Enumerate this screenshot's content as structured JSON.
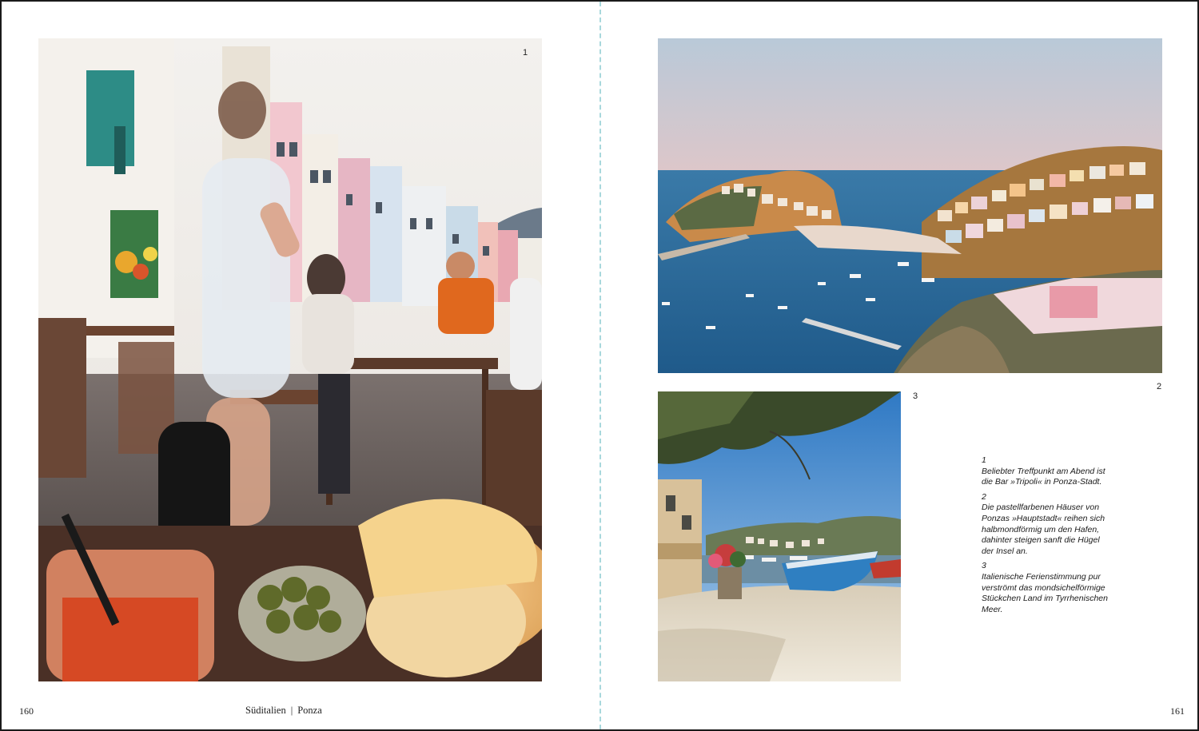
{
  "spread": {
    "left_folio": "160",
    "right_folio": "161",
    "running_head": {
      "region": "Süditalien",
      "separator": "|",
      "place": "Ponza"
    }
  },
  "photos": [
    {
      "number": "1",
      "icon": "cafe-street-photo"
    },
    {
      "number": "2",
      "icon": "harbor-town-photo"
    },
    {
      "number": "3",
      "icon": "beach-boat-photo"
    }
  ],
  "captions": [
    {
      "number": "1",
      "text": "Beliebter Treffpunkt am Abend ist die Bar »Tripoli« in Ponza-Stadt."
    },
    {
      "number": "2",
      "text": "Die pastellfarbenen Häuser von Ponzas »Hauptstadt« reihen sich halbmondförmig um den Hafen, dahinter steigen sanft die Hügel der Insel an."
    },
    {
      "number": "3",
      "text": "Italienische Ferienstimmung pur verströmt das mondsichelförmige Stückchen Land im Tyrrhenischen Meer."
    }
  ],
  "colors": {
    "gutter": "#a8d8dc",
    "border": "#1a1a1a"
  }
}
